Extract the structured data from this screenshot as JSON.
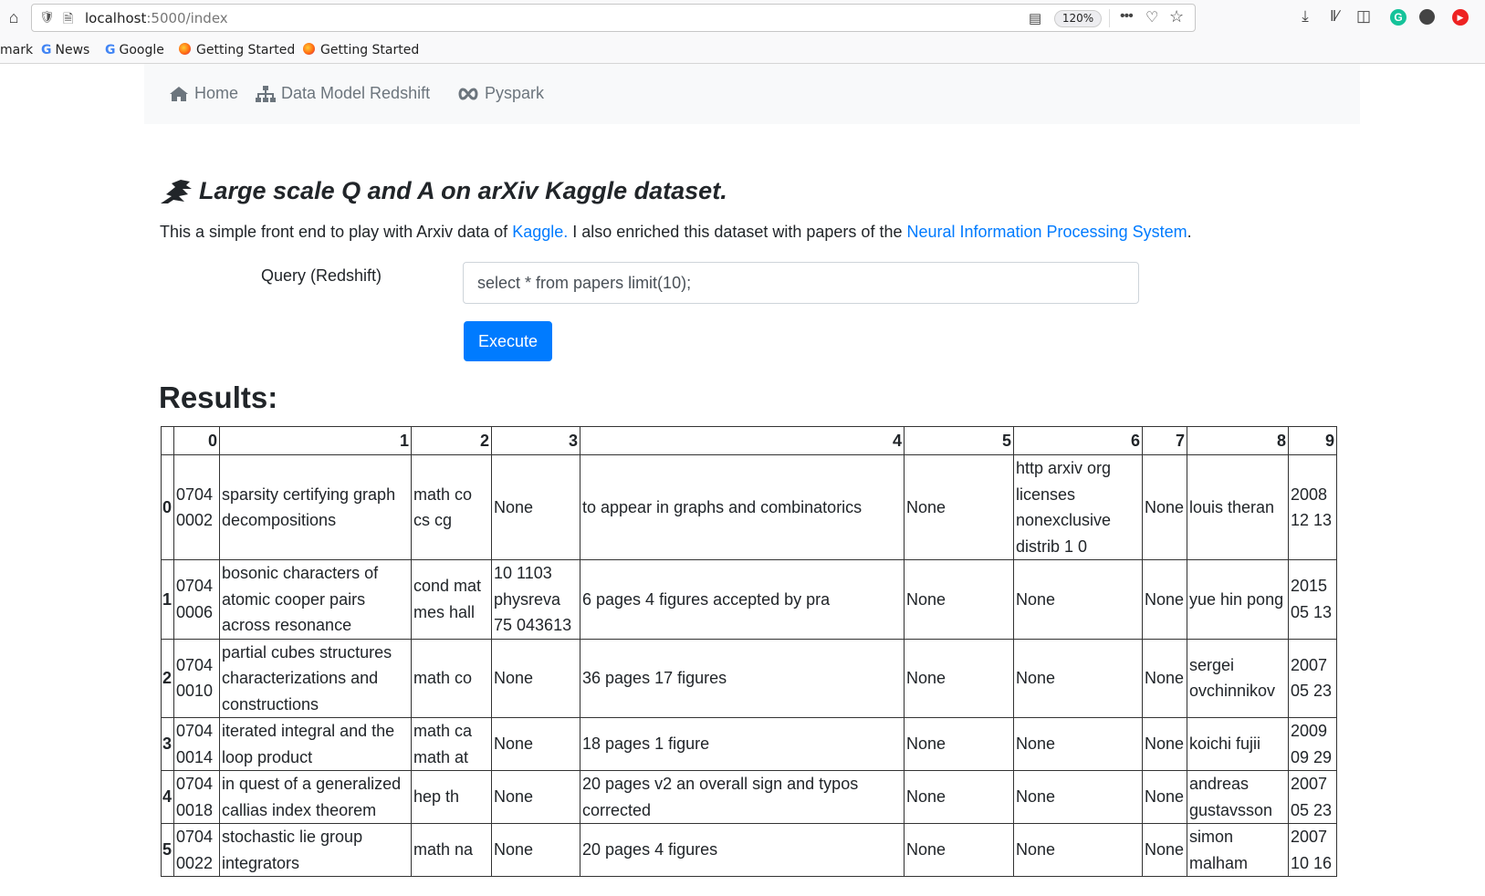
{
  "browser": {
    "url_host": "localhost",
    "url_rest": ":5000/index",
    "zoom": "120%",
    "bookmarks": [
      {
        "label": "mark",
        "icon": "none"
      },
      {
        "label": "News",
        "icon": "google-icon"
      },
      {
        "label": "Google",
        "icon": "google-icon"
      },
      {
        "label": "Getting Started",
        "icon": "firefox-icon"
      },
      {
        "label": "Getting Started",
        "icon": "firefox-icon"
      }
    ]
  },
  "nav": {
    "home": "Home",
    "data_model": "Data Model Redshift",
    "pyspark": "Pyspark"
  },
  "header": {
    "title": "Large scale Q and A on arXiv Kaggle dataset.",
    "intro_before": "This a simple front end to play with Arxiv data of ",
    "kaggle_link": "Kaggle.",
    "intro_middle": " I also enriched this dataset with papers of the ",
    "neurips_link": "Neural Information Processing System",
    "intro_after": "."
  },
  "query": {
    "label": "Query (Redshift)",
    "value": "select * from papers limit(10);",
    "execute_label": "Execute"
  },
  "results": {
    "title": "Results:",
    "columns": [
      "0",
      "1",
      "2",
      "3",
      "4",
      "5",
      "6",
      "7",
      "8",
      "9"
    ],
    "rows": [
      {
        "index": "0",
        "cells": [
          "0704 0002",
          "sparsity certifying graph decompositions",
          "math co cs cg",
          "None",
          "to appear in graphs and combinatorics",
          "None",
          "http arxiv org licenses nonexclusive distrib 1 0",
          "None",
          "louis theran",
          "2008 12 13"
        ]
      },
      {
        "index": "1",
        "cells": [
          "0704 0006",
          "bosonic characters of atomic cooper pairs across resonance",
          "cond mat mes hall",
          "10 1103 physreva 75 043613",
          "6 pages 4 figures accepted by pra",
          "None",
          "None",
          "None",
          "yue hin pong",
          "2015 05 13"
        ]
      },
      {
        "index": "2",
        "cells": [
          "0704 0010",
          "partial cubes structures characterizations and constructions",
          "math co",
          "None",
          "36 pages 17 figures",
          "None",
          "None",
          "None",
          "sergei ovchinnikov",
          "2007 05 23"
        ]
      },
      {
        "index": "3",
        "cells": [
          "0704 0014",
          "iterated integral and the loop product",
          "math ca math at",
          "None",
          "18 pages 1 figure",
          "None",
          "None",
          "None",
          "koichi fujii",
          "2009 09 29"
        ]
      },
      {
        "index": "4",
        "cells": [
          "0704 0018",
          "in quest of a generalized callias index theorem",
          "hep th",
          "None",
          "20 pages v2 an overall sign and typos corrected",
          "None",
          "None",
          "None",
          "andreas gustavsson",
          "2007 05 23"
        ]
      },
      {
        "index": "5",
        "cells": [
          "0704 0022",
          "stochastic lie group integrators",
          "math na",
          "None",
          "20 pages 4 figures",
          "None",
          "None",
          "None",
          "simon malham",
          "2007 10 16"
        ]
      }
    ]
  },
  "colors": {
    "link": "#007bff",
    "button": "#007bff",
    "navbar_bg": "#f8f9fa",
    "nav_text": "#6c757d"
  }
}
